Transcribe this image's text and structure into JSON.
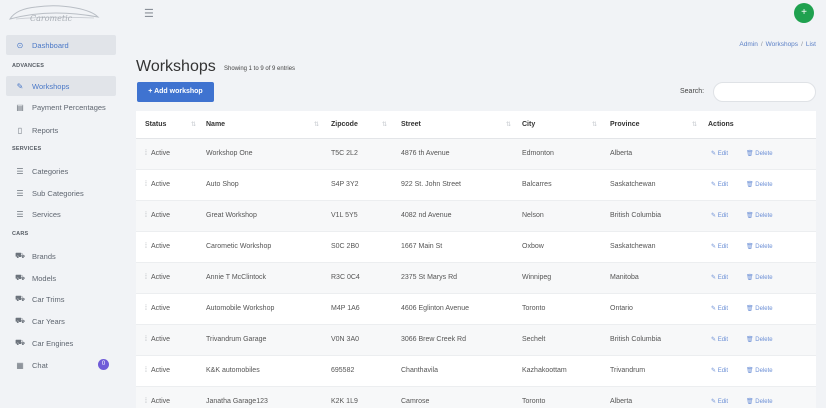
{
  "brand": {
    "logo_text": "Carometic"
  },
  "sidebar": {
    "dashboard": "Dashboard",
    "section_advances": "ADVANCES",
    "workshops": "Workshops",
    "payment_percentages": "Payment Percentages",
    "reports": "Reports",
    "section_services": "SERVICES",
    "categories": "Categories",
    "sub_categories": "Sub Categories",
    "services": "Services",
    "section_cars": "CARS",
    "brands": "Brands",
    "models": "Models",
    "car_trims": "Car Trims",
    "car_years": "Car Years",
    "car_engines": "Car Engines",
    "chat": "Chat",
    "chat_badge": "0"
  },
  "topbar": {
    "avatar_initial": "+"
  },
  "breadcrumb": {
    "admin": "Admin",
    "sep": "/",
    "workshops": "Workshops",
    "current": "List"
  },
  "page": {
    "title": "Workshops",
    "entries": "Showing 1 to 9 of 9 entries",
    "add_button": "+ Add workshop",
    "search_label": "Search:",
    "search_value": ""
  },
  "table": {
    "headers": {
      "status": "Status",
      "name": "Name",
      "zipcode": "Zipcode",
      "street": "Street",
      "city": "City",
      "province": "Province",
      "actions": "Actions"
    },
    "edit_label": "Edit",
    "delete_label": "Delete",
    "rows": [
      {
        "status": "Active",
        "name": "Workshop One",
        "zipcode": "T5C 2L2",
        "street": "4876 th Avenue",
        "city": "Edmonton",
        "province": "Alberta"
      },
      {
        "status": "Active",
        "name": "Auto Shop",
        "zipcode": "S4P 3Y2",
        "street": "922 St. John Street",
        "city": "Balcarres",
        "province": "Saskatchewan"
      },
      {
        "status": "Active",
        "name": "Great Workshop",
        "zipcode": "V1L 5Y5",
        "street": "4082 nd Avenue",
        "city": "Nelson",
        "province": "British Columbia"
      },
      {
        "status": "Active",
        "name": "Carometic Workshop",
        "zipcode": "S0C 2B0",
        "street": "1667 Main St",
        "city": "Oxbow",
        "province": "Saskatchewan"
      },
      {
        "status": "Active",
        "name": "Annie T McClintock",
        "zipcode": "R3C 0C4",
        "street": "2375 St Marys Rd",
        "city": "Winnipeg",
        "province": "Manitoba"
      },
      {
        "status": "Active",
        "name": "Automobile Workshop",
        "zipcode": "M4P 1A6",
        "street": "4606 Eglinton Avenue",
        "city": "Toronto",
        "province": "Ontario"
      },
      {
        "status": "Active",
        "name": "Trivandrum Garage",
        "zipcode": "V0N 3A0",
        "street": "3066 Brew Creek Rd",
        "city": "Sechelt",
        "province": "British Columbia"
      },
      {
        "status": "Active",
        "name": "K&K automobiles",
        "zipcode": "695582",
        "street": "Chanthavila",
        "city": "Kazhakoottam",
        "province": "Trivandrum"
      },
      {
        "status": "Active",
        "name": "Janatha Garage123",
        "zipcode": "K2K 1L9",
        "street": "Camrose",
        "city": "Toronto",
        "province": "Alberta"
      }
    ]
  }
}
